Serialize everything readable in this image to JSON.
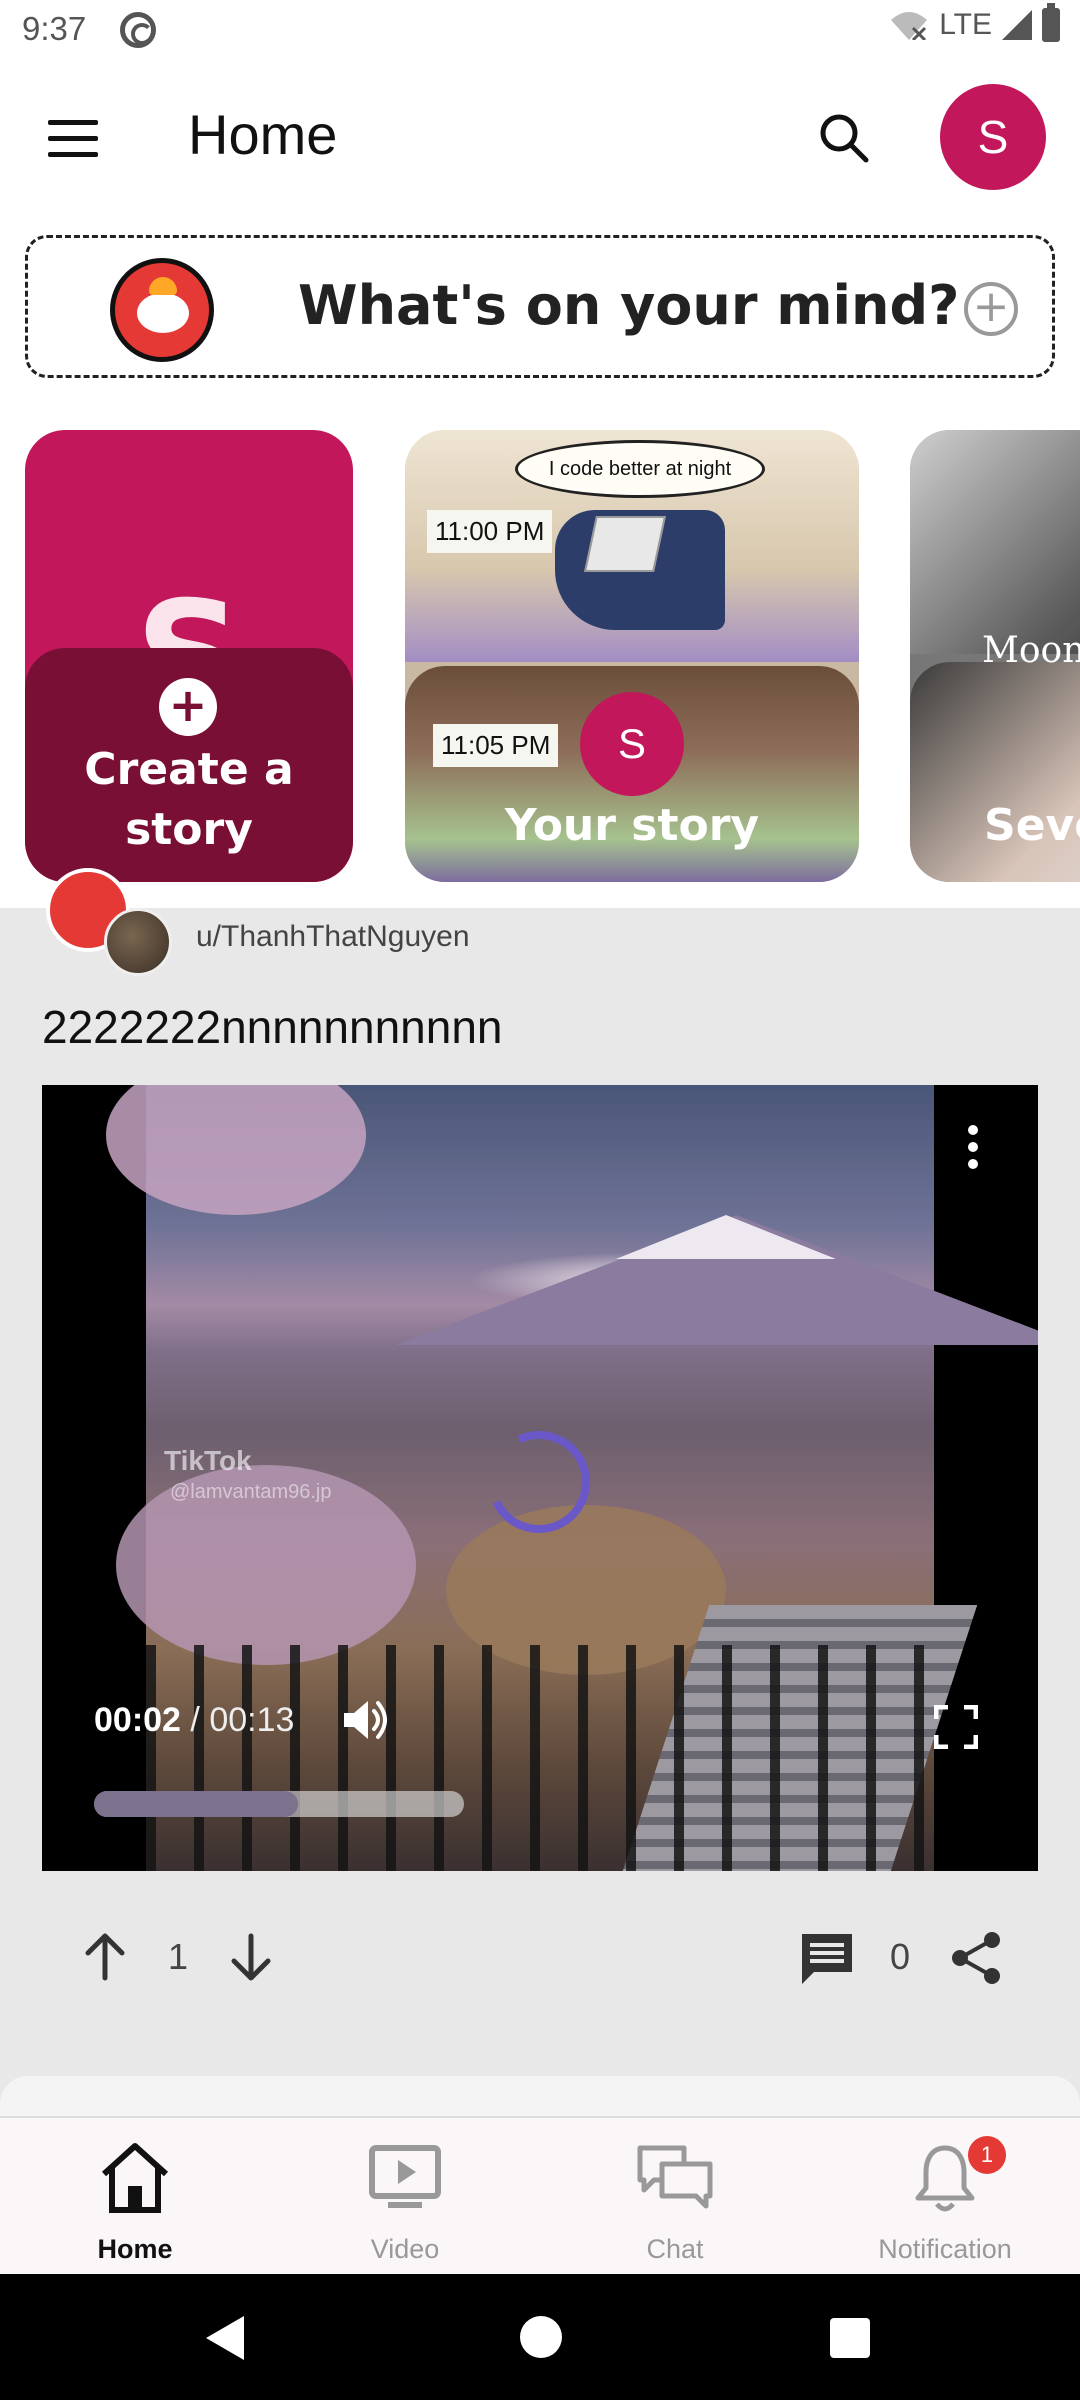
{
  "status_bar": {
    "time": "9:37",
    "network": "LTE"
  },
  "app_bar": {
    "title": "Home",
    "avatar_letter": "S"
  },
  "composer": {
    "prompt": "What's on your mind?"
  },
  "stories": [
    {
      "label": "Create a story",
      "letter": "S"
    },
    {
      "label": "Your story",
      "avatar_letter": "S",
      "meme_caption": "I code better at night",
      "time_top": "11:00 PM",
      "time_bottom": "11:05 PM"
    },
    {
      "label": "Seve",
      "overlay_text": "Moon"
    }
  ],
  "post": {
    "author": "u/ThanhThatNguyen",
    "title": "2222222nnnnnnnnnnn",
    "video": {
      "watermark": "TikTok",
      "watermark_handle": "@lamvantam96.jp",
      "current_time": "00:02",
      "separator": " / ",
      "duration": "00:13",
      "buffered_fraction": 0.55
    },
    "votes": "1",
    "comments": "0"
  },
  "bottom_nav": [
    {
      "label": "Home",
      "icon": "home-icon",
      "active": true
    },
    {
      "label": "Video",
      "icon": "video-icon",
      "active": false
    },
    {
      "label": "Chat",
      "icon": "chat-icon",
      "active": false
    },
    {
      "label": "Notification",
      "icon": "bell-icon",
      "active": false,
      "badge": "1"
    }
  ],
  "colors": {
    "accent": "#c2185b",
    "accent_dark": "#7a0f35",
    "spinner": "#6a58c8",
    "badge": "#e53935"
  }
}
